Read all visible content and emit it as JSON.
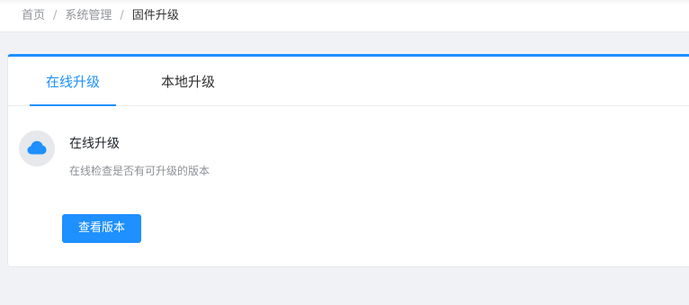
{
  "breadcrumb": {
    "items": [
      "首页",
      "系统管理",
      "固件升级"
    ],
    "separator": "/"
  },
  "tabs": [
    {
      "label": "在线升级",
      "active": true
    },
    {
      "label": "本地升级",
      "active": false
    }
  ],
  "online_upgrade": {
    "icon": "cloud-icon",
    "title": "在线升级",
    "description": "在线检查是否有可升级的版本",
    "button_label": "查看版本"
  },
  "colors": {
    "accent": "#1e90ff",
    "background": "#f0f2f5"
  }
}
